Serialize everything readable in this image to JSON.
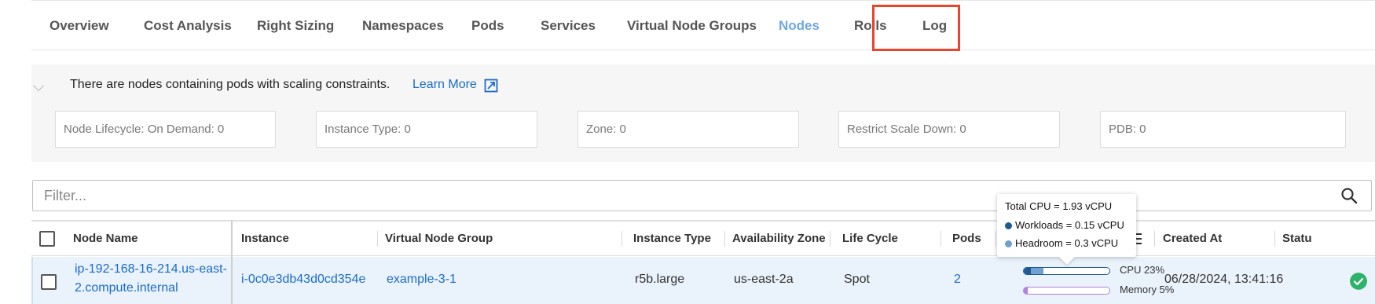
{
  "tabs": [
    {
      "label": "Overview",
      "active": false
    },
    {
      "label": "Cost Analysis",
      "active": false
    },
    {
      "label": "Right Sizing",
      "active": false
    },
    {
      "label": "Namespaces",
      "active": false
    },
    {
      "label": "Pods",
      "active": false
    },
    {
      "label": "Services",
      "active": false
    },
    {
      "label": "Virtual Node Groups",
      "active": false
    },
    {
      "label": "Nodes",
      "active": true
    },
    {
      "label": "Rolls",
      "active": false
    },
    {
      "label": "Log",
      "active": false
    }
  ],
  "constraints": {
    "notice": "There are nodes containing pods with scaling constraints.",
    "learn_more": "Learn More",
    "filters": [
      "Node Lifecycle: On Demand: 0",
      "Instance Type: 0",
      "Zone: 0",
      "Restrict Scale Down: 0",
      "PDB: 0"
    ]
  },
  "filter": {
    "placeholder": "Filter..."
  },
  "table": {
    "columns": {
      "node_name": "Node Name",
      "instance": "Instance",
      "virtual_node_group": "Virtual Node Group",
      "instance_type": "Instance Type",
      "availability_zone": "Availability Zone",
      "life_cycle": "Life Cycle",
      "pods": "Pods",
      "created_at": "Created At",
      "status": "Statu"
    },
    "rows": [
      {
        "node_name_line1": "ip-192-168-16-214.us-east-",
        "node_name_line2": "2.compute.internal",
        "instance": "i-0c0e3db43d0cd354e",
        "virtual_node_group": "example-3-1",
        "instance_type": "r5b.large",
        "availability_zone": "us-east-2a",
        "life_cycle": "Spot",
        "pods": "2",
        "cpu_label": "CPU 23%",
        "cpu_workloads_fraction": 0.08,
        "cpu_headroom_fraction": 0.15,
        "memory_label": "Memory 5%",
        "memory_fraction": 0.05,
        "created_at": "06/28/2024, 13:41:16",
        "status": "ok"
      }
    ]
  },
  "tooltip": {
    "title": "Total CPU = 1.93 vCPU",
    "workloads": "Workloads = 0.15 vCPU",
    "headroom": "Headroom = 0.3 vCPU"
  },
  "colors": {
    "accent": "#1a6bc9",
    "active_tab": "#6ea6e6",
    "highlight": "#e8452c",
    "workloads": "#1f5a96",
    "headroom": "#6fa0d2",
    "memory": "#b07fd9",
    "status_ok": "#2fb36a"
  },
  "icons": {
    "external_link": "external-link-icon",
    "search": "search-icon",
    "sort": "sort-down-icon",
    "menu": "menu-icon",
    "status": "check-circle-icon"
  }
}
